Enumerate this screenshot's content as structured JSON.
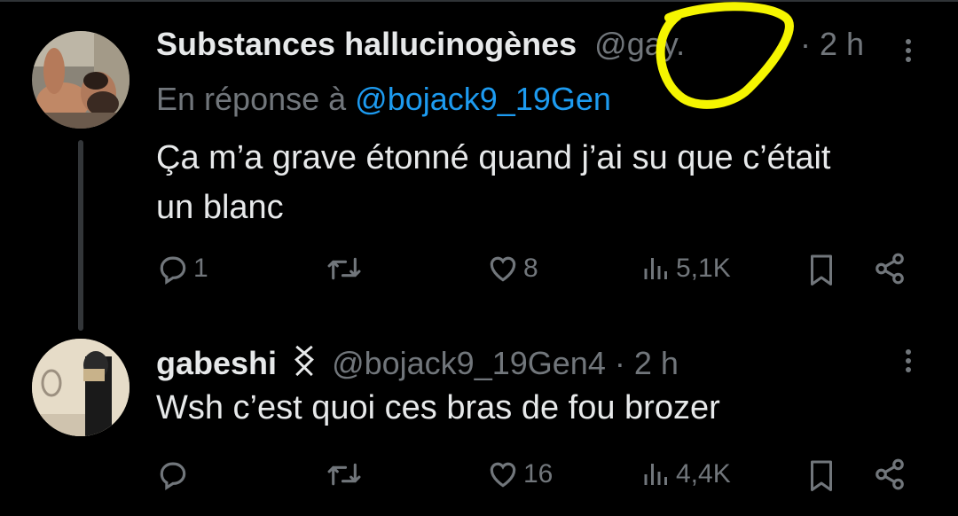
{
  "tweets": [
    {
      "name": "Substances hallucinogènes",
      "handle": "@gay.",
      "dot": "·",
      "time": "2 h",
      "reply_prefix": "En réponse à",
      "reply_mention": "@bojack9_19Gen",
      "text_line1": "Ça m’a grave étonné quand j’ai su que c’était",
      "text_line2": "un blanc",
      "replies": "1",
      "retweets": "",
      "likes": "8",
      "views": "5,1K"
    },
    {
      "name": "gabeshi",
      "handle": "@bojack9_19Gen4",
      "dot": "·",
      "time": "2 h",
      "text_line1": "Wsh c’est quoi ces bras de fou brozer",
      "replies": "",
      "retweets": "",
      "likes": "16",
      "views": "4,4K"
    }
  ],
  "icons": {
    "reply": "reply-icon",
    "retweet": "retweet-icon",
    "like": "heart-icon",
    "views": "views-icon",
    "bookmark": "bookmark-icon",
    "share": "share-icon",
    "more": "more-icon"
  },
  "colors": {
    "background": "#000000",
    "text": "#e7e9ea",
    "secondary": "#71767b",
    "link": "#1d9bf0",
    "annotation": "#f5f500"
  }
}
